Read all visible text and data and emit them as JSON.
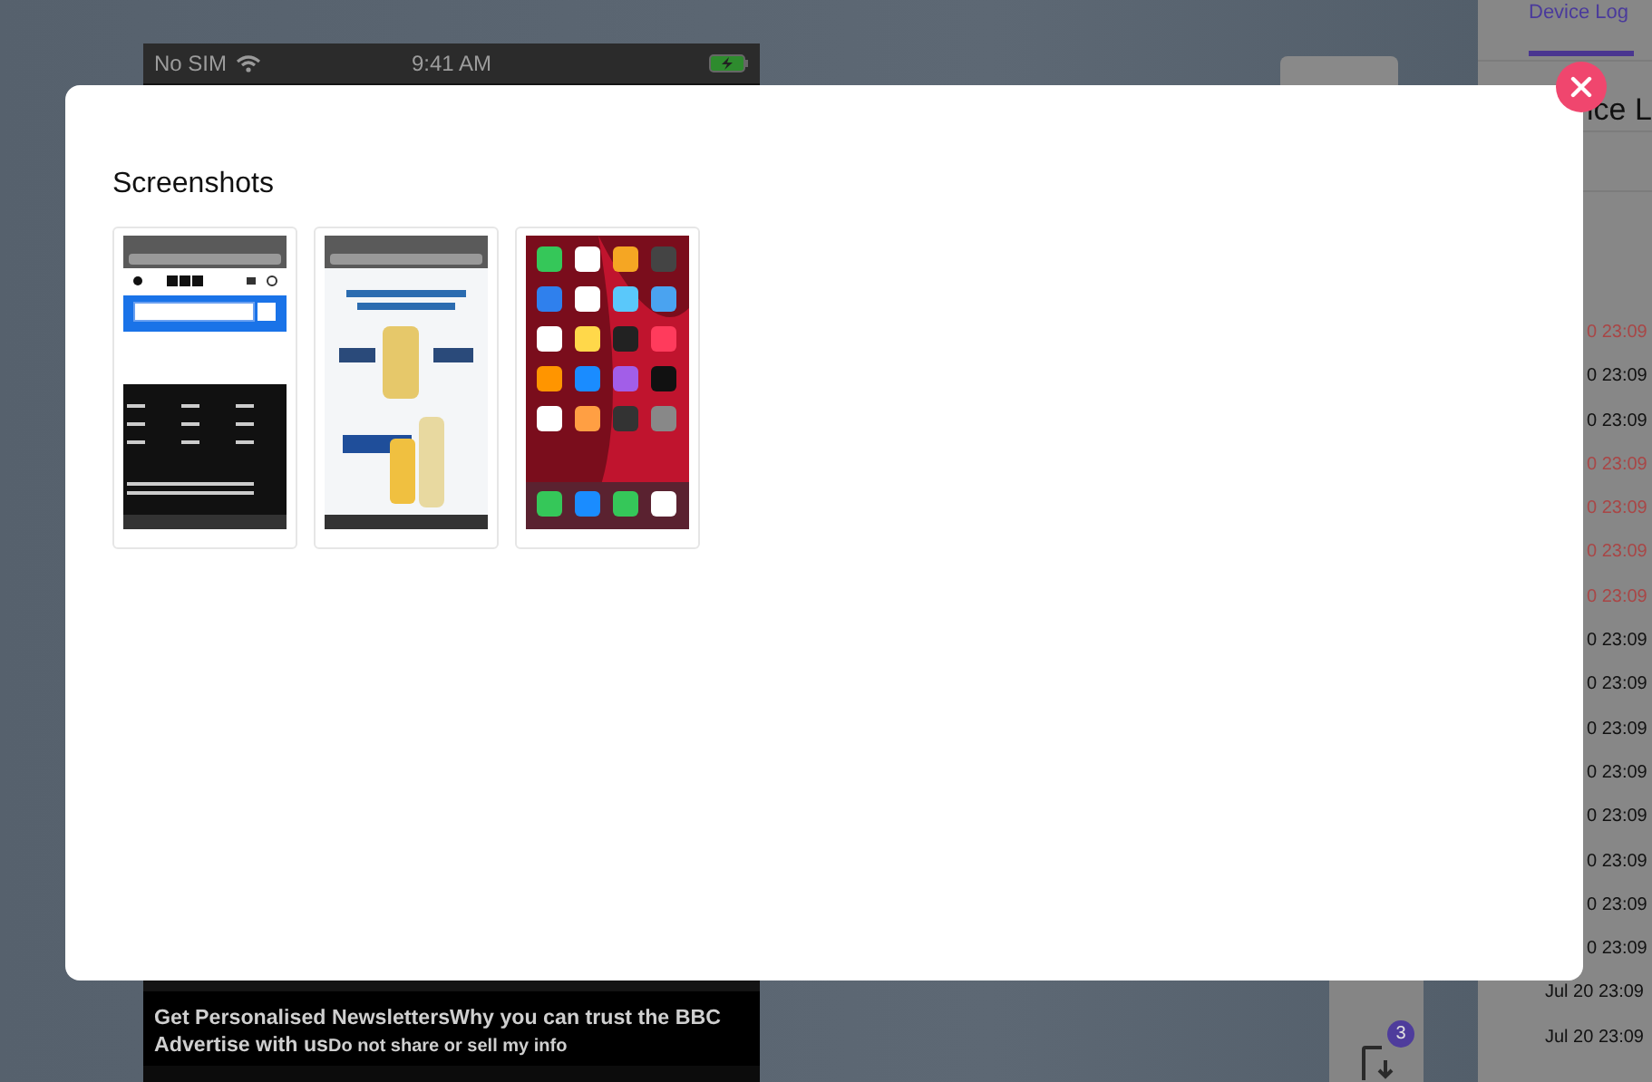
{
  "phone": {
    "status_bar": {
      "carrier": "No SIM",
      "time": "9:41 AM"
    },
    "footer": {
      "line": "Get Personalised NewslettersWhy you can trust the BBC",
      "last_line": {
        "link": "Advertise with us",
        "small_link": "Do not share or sell my info"
      }
    }
  },
  "toolbar": {
    "badge": "3"
  },
  "device_log": {
    "tab": {
      "label": "Device Log",
      "selected": true
    },
    "heading": "ice L",
    "partly_hidden_entries": [
      {
        "time": "0 23:09",
        "kind": "error"
      },
      {
        "time": "0 23:09",
        "kind": "info"
      },
      {
        "time": "0 23:09",
        "kind": "info"
      },
      {
        "time": "0 23:09",
        "kind": "error"
      },
      {
        "time": "0 23:09",
        "kind": "error"
      },
      {
        "time": "0 23:09",
        "kind": "error"
      },
      {
        "time": "0 23:09",
        "kind": "error"
      },
      {
        "time": "0 23:09",
        "kind": "info"
      },
      {
        "time": "0 23:09",
        "kind": "info"
      },
      {
        "time": "0 23:09",
        "kind": "info"
      },
      {
        "time": "0 23:09",
        "kind": "info"
      },
      {
        "time": "0 23:09",
        "kind": "info"
      },
      {
        "time": "0 23:09",
        "kind": "info"
      },
      {
        "time": "0 23:09",
        "kind": "info"
      },
      {
        "time": "0 23:09",
        "kind": "info"
      }
    ],
    "entries": [
      {
        "time": "Jul 20 23:09",
        "kind": "info"
      },
      {
        "time": "Jul 20 23:09",
        "kind": "info"
      }
    ]
  },
  "modal": {
    "title": "Screenshots",
    "thumbnails": [
      {
        "kind": "web-page"
      },
      {
        "kind": "advert"
      },
      {
        "kind": "home-screen"
      }
    ]
  }
}
